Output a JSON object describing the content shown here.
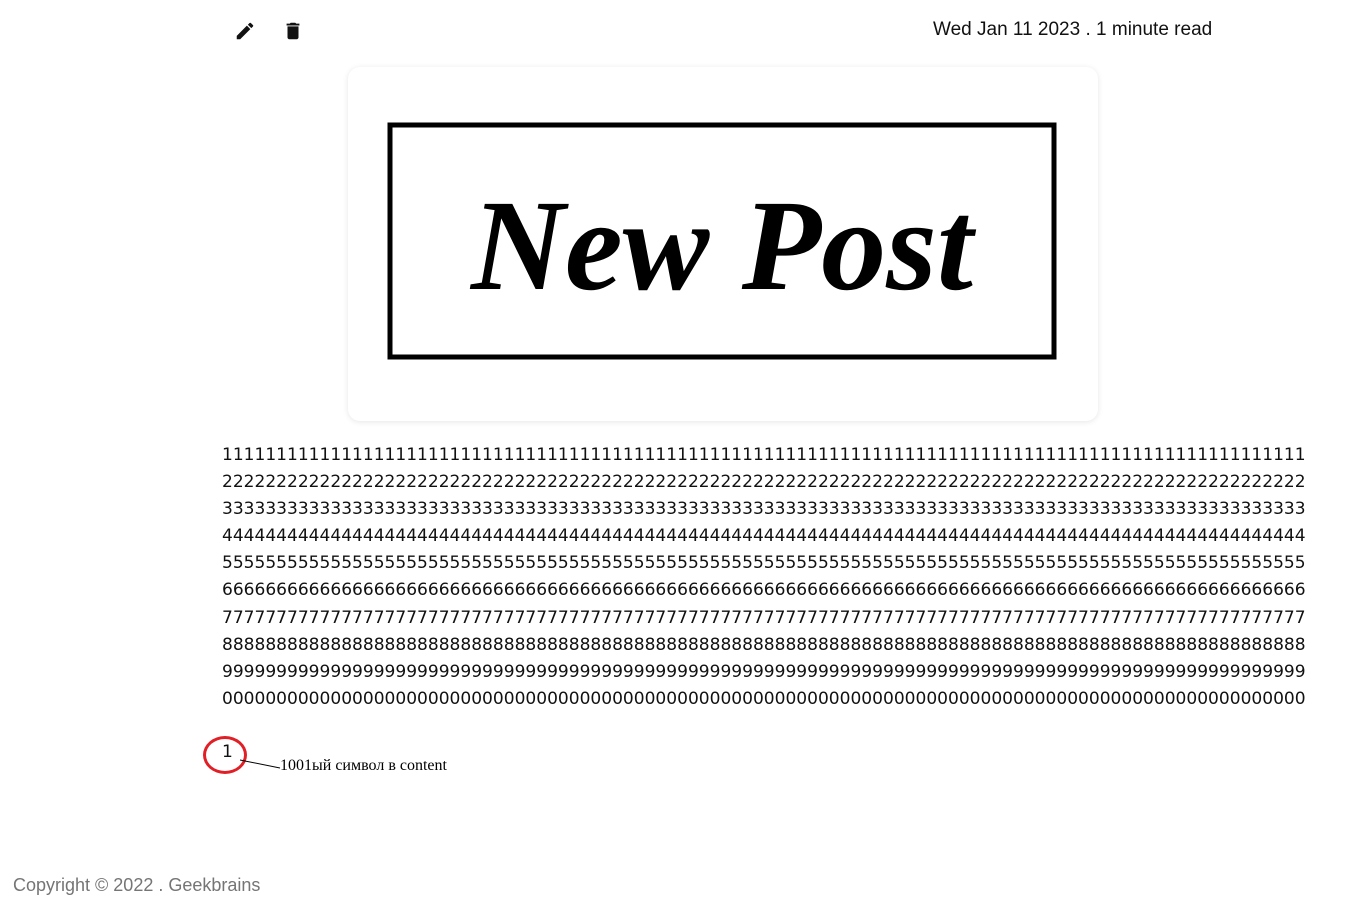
{
  "toolbar": {
    "edit_icon": "pencil-icon",
    "delete_icon": "trash-icon"
  },
  "post": {
    "meta": "Wed Jan 11 2023 . 1 minute read",
    "image_text": "New Post",
    "content_lines": [
      "1111111111111111111111111111111111111111111111111111111111111111111111111111111111111111111111111111",
      "2222222222222222222222222222222222222222222222222222222222222222222222222222222222222222222222222222",
      "3333333333333333333333333333333333333333333333333333333333333333333333333333333333333333333333333333",
      "4444444444444444444444444444444444444444444444444444444444444444444444444444444444444444444444444444",
      "5555555555555555555555555555555555555555555555555555555555555555555555555555555555555555555555555555",
      "6666666666666666666666666666666666666666666666666666666666666666666666666666666666666666666666666666",
      "7777777777777777777777777777777777777777777777777777777777777777777777777777777777777777777777777777",
      "8888888888888888888888888888888888888888888888888888888888888888888888888888888888888888888888888888",
      "9999999999999999999999999999999999999999999999999999999999999999999999999999999999999999999999999999",
      "0000000000000000000000000000000000000000000000000000000000000000000000000000000000000000000000000000"
    ],
    "overflow_char": "1"
  },
  "annotation": {
    "text": "1001ый символ в content",
    "color": "#e01f26"
  },
  "footer": {
    "copyright": "Copyright © 2022 . Geekbrains"
  }
}
